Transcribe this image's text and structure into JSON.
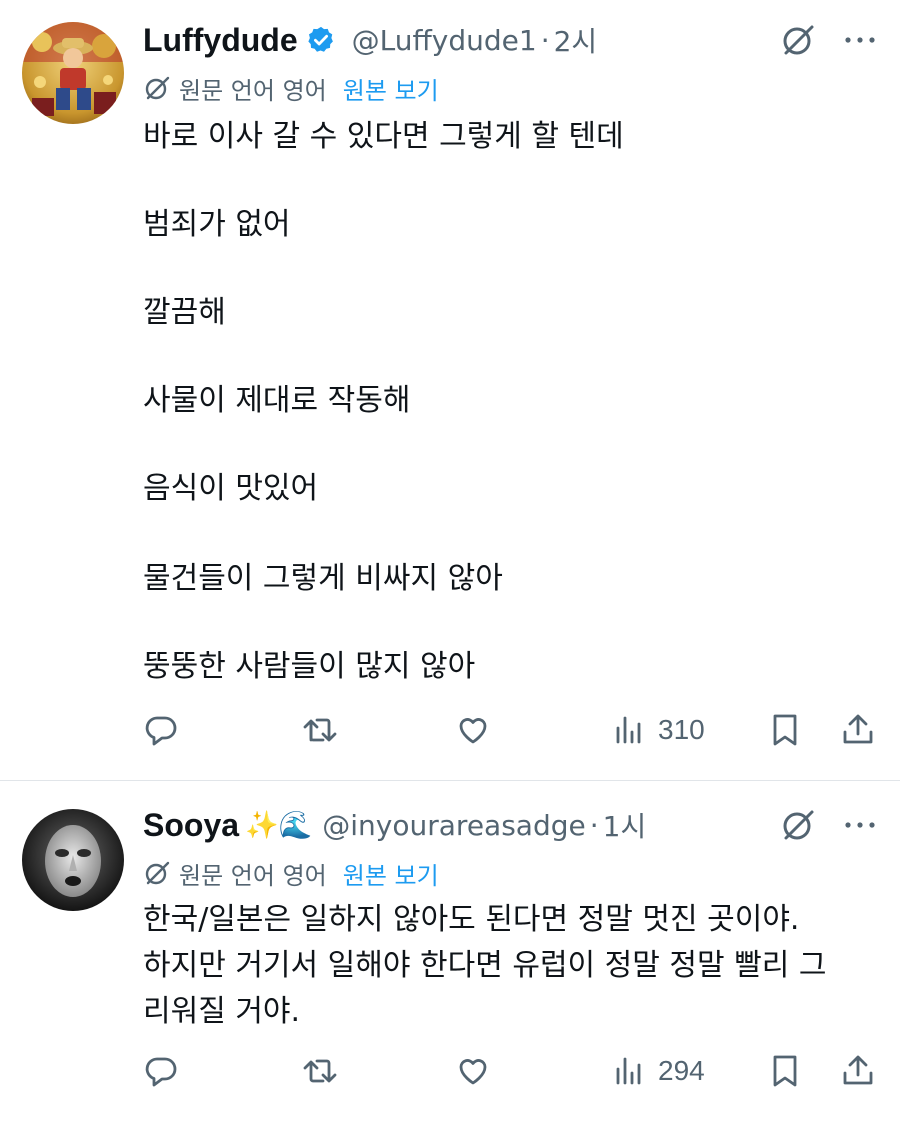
{
  "tweets": [
    {
      "author": {
        "name": "Luffydude",
        "handle": "@Luffydude1",
        "time": "2시",
        "verified": true,
        "emoji": ""
      },
      "translation": {
        "label": "원문 언어 영어",
        "link": "원본 보기"
      },
      "paragraphs": [
        "바로 이사 갈 수 있다면 그렇게 할 텐데",
        "범죄가 없어",
        "깔끔해",
        "사물이 제대로 작동해",
        "음식이 맛있어",
        "물건들이 그렇게 비싸지 않아",
        "뚱뚱한 사람들이 많지 않아"
      ],
      "views": "310",
      "icons": [
        "reply-icon",
        "retweet-icon",
        "like-icon",
        "views-icon",
        "bookmark-icon",
        "share-icon"
      ]
    },
    {
      "author": {
        "name": "Sooya",
        "handle": "@inyourareasadge",
        "time": "1시",
        "verified": false,
        "emoji": "✨🌊"
      },
      "translation": {
        "label": "원문 언어 영어",
        "link": "원본 보기"
      },
      "paragraphs": [
        "한국/일본은 일하지 않아도 된다면 정말 멋진 곳이야.",
        "하지만 거기서 일해야 한다면 유럽이 정말 정말 빨리 그",
        "리워질 거야."
      ],
      "views": "294",
      "icons": [
        "reply-icon",
        "retweet-icon",
        "like-icon",
        "views-icon",
        "bookmark-icon",
        "share-icon"
      ]
    }
  ],
  "colors": {
    "text": "#0f1419",
    "secondary": "#536471",
    "link": "#1d9bf0",
    "verified": "#1d9bf0",
    "divider": "#e1e5e9"
  }
}
